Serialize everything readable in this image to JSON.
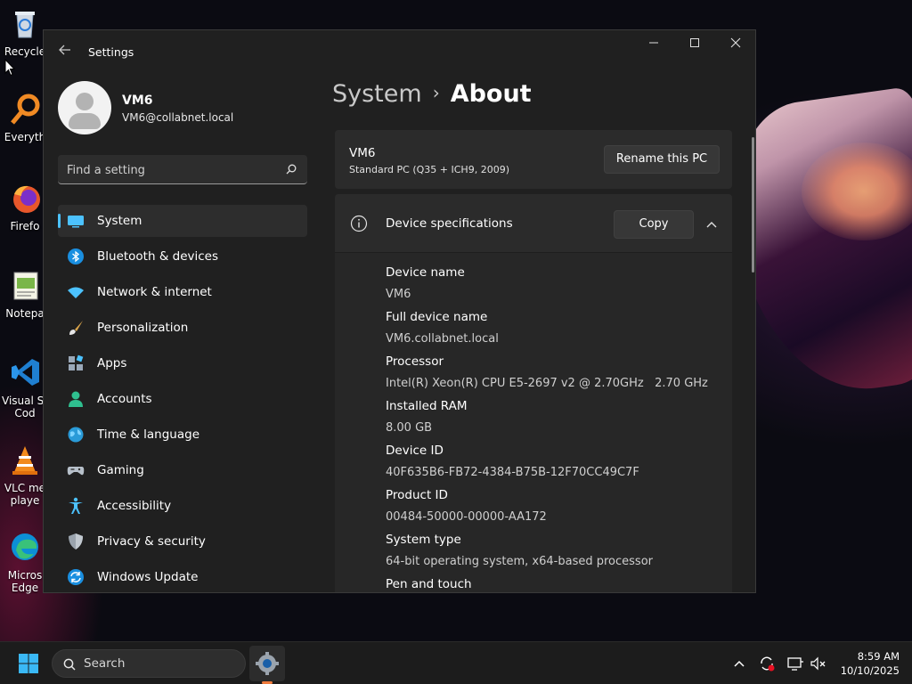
{
  "desktop": {
    "icons": [
      {
        "label": "Recycle",
        "icon": "recycle-bin-icon"
      },
      {
        "label": "Everyth",
        "icon": "everything-icon"
      },
      {
        "label": "Firefo",
        "icon": "firefox-icon"
      },
      {
        "label": "Notepa",
        "icon": "notepad-icon"
      },
      {
        "label": "Visual St",
        "label2": "Cod",
        "icon": "vscode-icon"
      },
      {
        "label": "VLC me",
        "label2": "playe",
        "icon": "vlc-icon"
      },
      {
        "label": "Micros",
        "label2": "Edge",
        "icon": "edge-icon"
      }
    ]
  },
  "window": {
    "title": "Settings",
    "controls": {
      "minimize": "─",
      "maximize": "☐",
      "close": "✕"
    }
  },
  "profile": {
    "name": "VM6",
    "email": "VM6@collabnet.local"
  },
  "search": {
    "placeholder": "Find a setting"
  },
  "sidebar": {
    "items": [
      {
        "label": "System",
        "icon": "system-icon",
        "selected": true
      },
      {
        "label": "Bluetooth & devices",
        "icon": "bluetooth-icon"
      },
      {
        "label": "Network & internet",
        "icon": "wifi-icon"
      },
      {
        "label": "Personalization",
        "icon": "brush-icon"
      },
      {
        "label": "Apps",
        "icon": "apps-icon"
      },
      {
        "label": "Accounts",
        "icon": "accounts-icon"
      },
      {
        "label": "Time & language",
        "icon": "globe-icon"
      },
      {
        "label": "Gaming",
        "icon": "gamepad-icon"
      },
      {
        "label": "Accessibility",
        "icon": "accessibility-icon"
      },
      {
        "label": "Privacy & security",
        "icon": "shield-icon"
      },
      {
        "label": "Windows Update",
        "icon": "update-icon"
      }
    ]
  },
  "breadcrumb": {
    "parent": "System",
    "separator": "›",
    "current": "About"
  },
  "pc_card": {
    "name": "VM6",
    "model": "Standard PC (Q35 + ICH9, 2009)",
    "rename_label": "Rename this PC"
  },
  "specs": {
    "title": "Device specifications",
    "copy_label": "Copy",
    "rows": [
      {
        "label": "Device name",
        "value": "VM6"
      },
      {
        "label": "Full device name",
        "value": "VM6.collabnet.local"
      },
      {
        "label": "Processor",
        "value": "Intel(R) Xeon(R) CPU E5-2697 v2 @ 2.70GHz   2.70 GHz"
      },
      {
        "label": "Installed RAM",
        "value": "8.00 GB"
      },
      {
        "label": "Device ID",
        "value": "40F635B6-FB72-4384-B75B-12F70CC49C7F"
      },
      {
        "label": "Product ID",
        "value": "00484-50000-00000-AA172"
      },
      {
        "label": "System type",
        "value": "64-bit operating system, x64-based processor"
      },
      {
        "label": "Pen and touch",
        "value": ""
      }
    ]
  },
  "taskbar": {
    "search_label": "Search",
    "time": "8:59 AM",
    "date": "10/10/2025"
  },
  "colors": {
    "accent": "#4cc2ff",
    "window_bg": "#202020",
    "card_bg": "#2b2b2b",
    "taskbar_bg": "#1c1c1c"
  }
}
